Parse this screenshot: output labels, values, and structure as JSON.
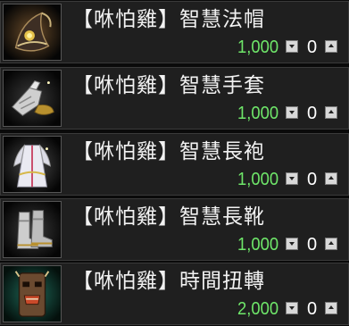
{
  "shop": {
    "items": [
      {
        "name": "【咻怕雞】智慧法帽",
        "price": "1,000",
        "quantity": "0",
        "icon": "wizard-hat-icon"
      },
      {
        "name": "【咻怕雞】智慧手套",
        "price": "1,000",
        "quantity": "0",
        "icon": "gauntlet-icon"
      },
      {
        "name": "【咻怕雞】智慧長袍",
        "price": "1,000",
        "quantity": "0",
        "icon": "robe-icon"
      },
      {
        "name": "【咻怕雞】智慧長靴",
        "price": "1,000",
        "quantity": "0",
        "icon": "boots-icon"
      },
      {
        "name": "【咻怕雞】時間扭轉",
        "price": "2,000",
        "quantity": "0",
        "icon": "totem-mask-icon"
      }
    ]
  },
  "colors": {
    "price": "#6fe76a",
    "row_background": "#1f1f1f",
    "row_border": "#3a3a3a",
    "name_text": "#f2f2f2"
  }
}
